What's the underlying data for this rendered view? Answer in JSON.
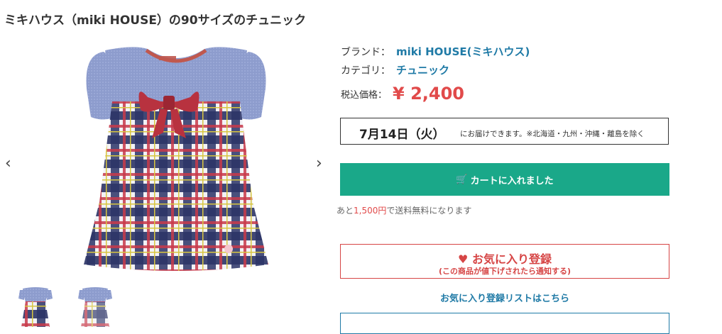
{
  "product": {
    "title": "ミキハウス（miki HOUSE）の90サイズのチュニック",
    "brand_label": "ブランド：",
    "brand": "miki HOUSE(ミキハウス)",
    "category_label": "カテゴリ：",
    "category": "チュニック",
    "price_label": "税込価格：",
    "price": "¥ 2,400"
  },
  "gallery": {
    "prev_icon": "‹",
    "next_icon": "›"
  },
  "delivery": {
    "date": "7月14日（火）",
    "note": "にお届けできます。※北海道・九州・沖縄・離島を除く"
  },
  "cart": {
    "icon": "🛒",
    "label": "カートに入れました"
  },
  "shipping": {
    "prefix": "あと",
    "amount": "1,500円",
    "suffix": "で送料無料になります"
  },
  "favorite": {
    "icon": "♥",
    "label": "お気に入り登録",
    "sub": "(この商品が値下げされたら通知する)",
    "list_link": "お気に入り登録リストはこちら"
  },
  "colors": {
    "accent_green": "#1aa889",
    "price_red": "#e14a4a",
    "link_blue": "#1f7aa6"
  }
}
